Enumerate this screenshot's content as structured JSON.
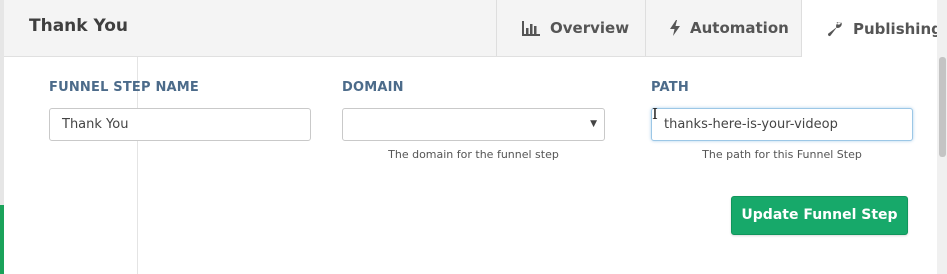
{
  "header": {
    "title": "Thank You",
    "tabs": [
      {
        "label": "Overview",
        "icon": "bar-chart-icon"
      },
      {
        "label": "Automation",
        "icon": "lightning-bolt-icon"
      },
      {
        "label": "Publishing",
        "icon": "wrench-icon",
        "active": true
      }
    ]
  },
  "form": {
    "step_name": {
      "label": "FUNNEL STEP NAME",
      "value": "Thank You"
    },
    "domain": {
      "label": "DOMAIN",
      "value": "",
      "help": "The domain for the funnel step"
    },
    "path": {
      "label": "PATH",
      "value": "thanks-here-is-your-videop",
      "help": "The path for this Funnel Step"
    },
    "submit_label": "Update Funnel Step"
  },
  "colors": {
    "accent_green": "#17a96a",
    "label_blue": "#4c6b8a",
    "focus_border": "#9cc7e6"
  }
}
